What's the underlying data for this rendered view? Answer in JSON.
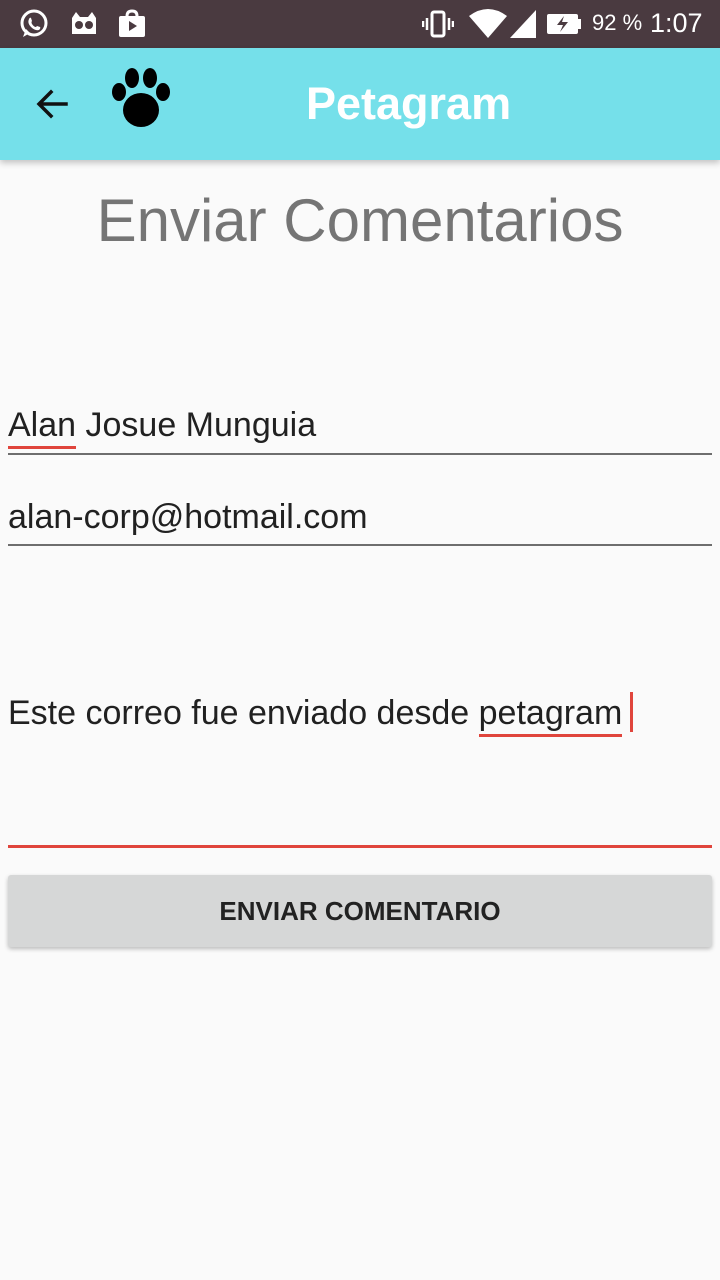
{
  "status_bar": {
    "battery_percent": "92 %",
    "time": "1:07",
    "left_icons": [
      "whatsapp-icon",
      "cat-android-icon",
      "shop-bag-icon"
    ],
    "right_icons": [
      "vibrate-icon",
      "wifi-icon",
      "signal-icon",
      "battery-charging-icon"
    ]
  },
  "app_bar": {
    "title": "Petagram",
    "back_icon": "back-arrow-icon",
    "logo_icon": "paw-icon"
  },
  "form": {
    "heading": "Enviar Comentarios",
    "name_first": "Alan",
    "name_rest": " Josue Munguia",
    "email": "alan-corp@hotmail.com",
    "message_start": "Este correo fue enviado desde ",
    "message_end": "petagram",
    "submit_label": "ENVIAR COMENTARIO"
  },
  "colors": {
    "app_bar": "#75e0ea",
    "status_bar": "#4a3a40",
    "accent_underline": "#e0453c",
    "button": "#d6d7d7"
  }
}
